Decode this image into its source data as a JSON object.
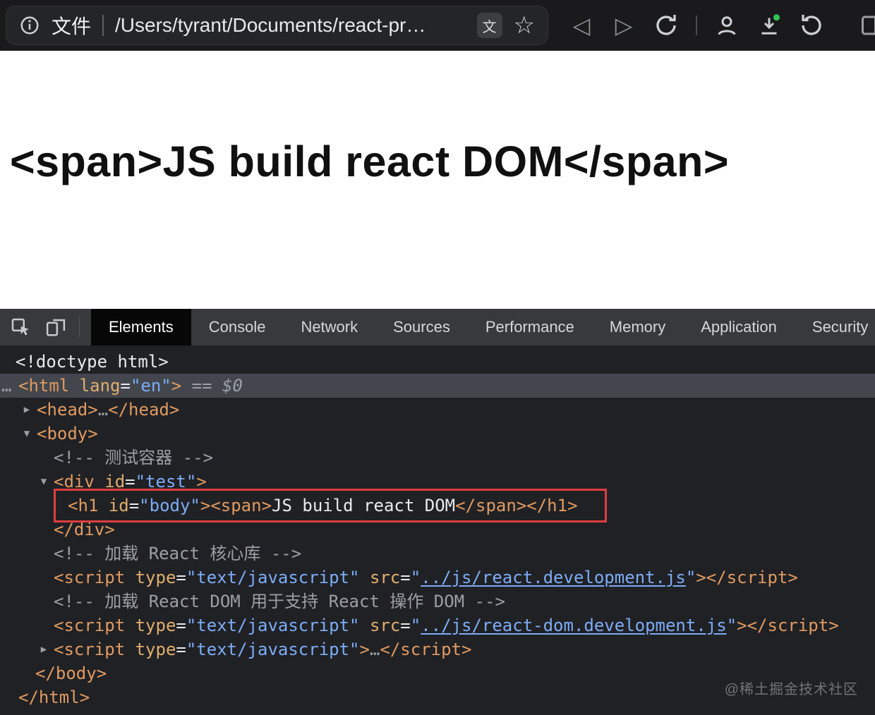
{
  "toolbar": {
    "file_label": "文件",
    "url": "/Users/tyrant/Documents/react-pr…",
    "translate_glyph": "文",
    "star_glyph": "☆",
    "back_glyph": "◁",
    "forward_glyph": "▷"
  },
  "page": {
    "heading": "<span>JS build react DOM</span>"
  },
  "devtools": {
    "active_tab": "Elements",
    "tabs": [
      "Elements",
      "Console",
      "Network",
      "Sources",
      "Performance",
      "Memory",
      "Application",
      "Security"
    ],
    "watermark": "@稀土掘金技术社区",
    "colors": {
      "background": "#202124",
      "selection": "#43474d",
      "highlight_border": "#df3e3e",
      "tag": "#e09a62",
      "attribute_value": "#7cacf8",
      "comment": "#9aa0a6"
    },
    "tree": [
      {
        "name": "node-doctype",
        "pad": 22,
        "tokens": [
          {
            "t": "<!doctype html>",
            "c": "doctype"
          }
        ]
      },
      {
        "name": "node-html-open",
        "pad": 26,
        "selected": true,
        "leader": "…",
        "tokens": [
          {
            "t": "<html",
            "c": "tag"
          },
          {
            "t": " lang",
            "c": "attr"
          },
          {
            "t": "=",
            "c": "text"
          },
          {
            "t": "\"en\"",
            "c": "val"
          },
          {
            "t": ">",
            "c": "tag"
          },
          {
            "t": " == ",
            "c": "gray"
          },
          {
            "t": "$0",
            "c": "dollar"
          }
        ]
      },
      {
        "name": "node-head",
        "pad": 52,
        "arrow": "right",
        "tokens": [
          {
            "t": "<head>",
            "c": "tag"
          },
          {
            "t": "…",
            "c": "gray"
          },
          {
            "t": "</head>",
            "c": "tag"
          }
        ]
      },
      {
        "name": "node-body-open",
        "pad": 52,
        "arrow": "down",
        "tokens": [
          {
            "t": "<body>",
            "c": "tag"
          }
        ]
      },
      {
        "name": "comment-test-container",
        "pad": 76,
        "tokens": [
          {
            "t": "<!-- 测试容器 -->",
            "c": "comment"
          }
        ]
      },
      {
        "name": "node-div-test-open",
        "pad": 76,
        "arrow": "down",
        "tokens": [
          {
            "t": "<div",
            "c": "tag"
          },
          {
            "t": " id",
            "c": "attr"
          },
          {
            "t": "=",
            "c": "text"
          },
          {
            "t": "\"test\"",
            "c": "val"
          },
          {
            "t": ">",
            "c": "tag"
          }
        ]
      },
      {
        "name": "node-h1-body",
        "pad": 96,
        "boxed": true,
        "tokens": [
          {
            "t": "<h1",
            "c": "tag"
          },
          {
            "t": " id",
            "c": "attr"
          },
          {
            "t": "=",
            "c": "text"
          },
          {
            "t": "\"body\"",
            "c": "val"
          },
          {
            "t": ">",
            "c": "tag"
          },
          {
            "t": "<span>",
            "c": "tag"
          },
          {
            "t": "JS build react DOM",
            "c": "text"
          },
          {
            "t": "</span>",
            "c": "tag"
          },
          {
            "t": "</h1>",
            "c": "tag"
          }
        ]
      },
      {
        "name": "node-div-test-close",
        "pad": 76,
        "tokens": [
          {
            "t": "</div>",
            "c": "tag"
          }
        ]
      },
      {
        "name": "comment-load-react-core",
        "pad": 76,
        "tokens": [
          {
            "t": "<!-- 加载 React 核心库 -->",
            "c": "comment"
          }
        ]
      },
      {
        "name": "node-script-react",
        "pad": 76,
        "tokens": [
          {
            "t": "<script",
            "c": "tag"
          },
          {
            "t": " type",
            "c": "attr"
          },
          {
            "t": "=",
            "c": "text"
          },
          {
            "t": "\"text/javascript\"",
            "c": "val"
          },
          {
            "t": " src",
            "c": "attr"
          },
          {
            "t": "=",
            "c": "text"
          },
          {
            "t": "\"",
            "c": "val"
          },
          {
            "t": "../js/react.development.js",
            "c": "link"
          },
          {
            "t": "\"",
            "c": "val"
          },
          {
            "t": ">",
            "c": "tag"
          },
          {
            "t": "</script>",
            "c": "tag"
          }
        ]
      },
      {
        "name": "comment-load-react-dom",
        "pad": 76,
        "tokens": [
          {
            "t": "<!-- 加载 React DOM 用于支持 React 操作 DOM -->",
            "c": "comment"
          }
        ]
      },
      {
        "name": "node-script-react-dom",
        "pad": 76,
        "tokens": [
          {
            "t": "<script",
            "c": "tag"
          },
          {
            "t": " type",
            "c": "attr"
          },
          {
            "t": "=",
            "c": "text"
          },
          {
            "t": "\"text/javascript\"",
            "c": "val"
          },
          {
            "t": " src",
            "c": "attr"
          },
          {
            "t": "=",
            "c": "text"
          },
          {
            "t": "\"",
            "c": "val"
          },
          {
            "t": "../js/react-dom.development.js",
            "c": "link"
          },
          {
            "t": "\"",
            "c": "val"
          },
          {
            "t": ">",
            "c": "tag"
          },
          {
            "t": "</script>",
            "c": "tag"
          }
        ]
      },
      {
        "name": "node-script-inline",
        "pad": 76,
        "arrow": "right",
        "tokens": [
          {
            "t": "<script",
            "c": "tag"
          },
          {
            "t": " type",
            "c": "attr"
          },
          {
            "t": "=",
            "c": "text"
          },
          {
            "t": "\"text/javascript\"",
            "c": "val"
          },
          {
            "t": ">",
            "c": "tag"
          },
          {
            "t": "…",
            "c": "gray"
          },
          {
            "t": "</script>",
            "c": "tag"
          }
        ]
      },
      {
        "name": "node-body-close",
        "pad": 50,
        "tokens": [
          {
            "t": "</body>",
            "c": "tag"
          }
        ]
      },
      {
        "name": "node-html-close",
        "pad": 26,
        "tokens": [
          {
            "t": "</html>",
            "c": "tag"
          }
        ]
      }
    ]
  }
}
